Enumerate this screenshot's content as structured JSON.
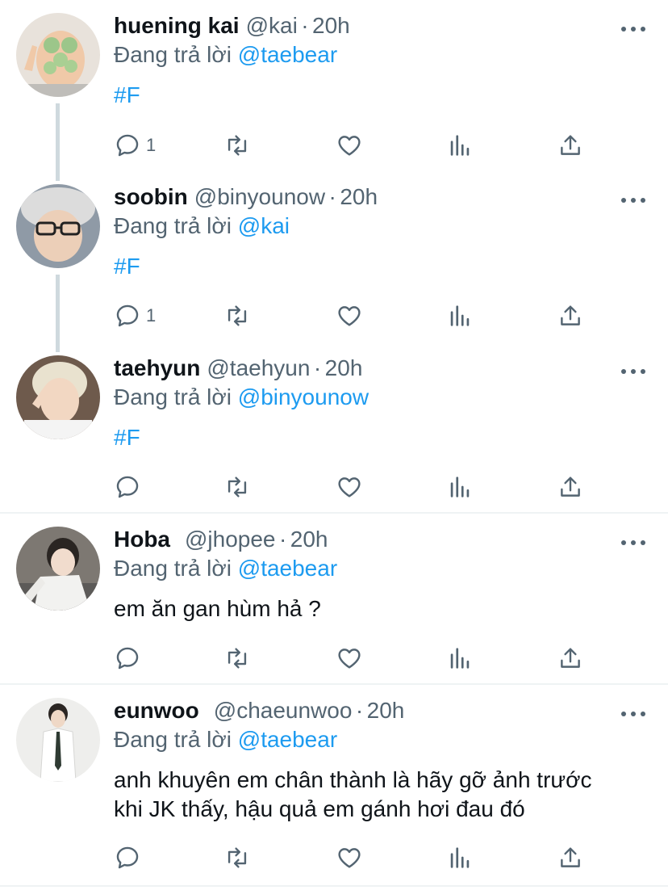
{
  "tweets": [
    {
      "name": "huening kai",
      "handle": "@kai",
      "dot": "·",
      "time": "20h",
      "reply_prefix": "Đang trả lời ",
      "reply_to": "@taebear",
      "text": "#F",
      "reply_count": "1",
      "avatar": "avatar-huening-kai"
    },
    {
      "name": "soobin",
      "handle": "@binyounow",
      "dot": "·",
      "time": "20h",
      "reply_prefix": "Đang trả lời ",
      "reply_to": "@kai",
      "text": "#F",
      "reply_count": "1",
      "avatar": "avatar-soobin"
    },
    {
      "name": "taehyun",
      "handle": "@taehyun",
      "dot": "·",
      "time": "20h",
      "reply_prefix": "Đang trả lời ",
      "reply_to": "@binyounow",
      "text": "#F",
      "reply_count": "",
      "avatar": "avatar-taehyun"
    },
    {
      "name": "Hoba",
      "handle": "@jhopee",
      "dot": "·",
      "time": "20h",
      "reply_prefix": "Đang trả lời ",
      "reply_to": "@taebear",
      "text": "em ăn gan hùm hả ?",
      "reply_count": "",
      "avatar": "avatar-hoba"
    },
    {
      "name": "eunwoo",
      "handle": "@chaeunwoo",
      "dot": "·",
      "time": "20h",
      "reply_prefix": "Đang trả lời ",
      "reply_to": "@taebear",
      "text_line1": "anh khuyên em chân thành là hãy gỡ ảnh trước",
      "text_line2": "khi JK thấy, hậu quả em gánh hơi đau đó",
      "reply_count": "",
      "avatar": "avatar-eunwoo"
    }
  ],
  "icons": [
    "reply-icon",
    "retweet-icon",
    "like-icon",
    "analytics-icon",
    "share-icon",
    "more-icon"
  ],
  "colors": {
    "accent": "#1d9bf0",
    "secondary_text": "#536471",
    "primary_text": "#0f1419",
    "divider": "#eff3f4",
    "thread_line": "#cfd9de"
  }
}
